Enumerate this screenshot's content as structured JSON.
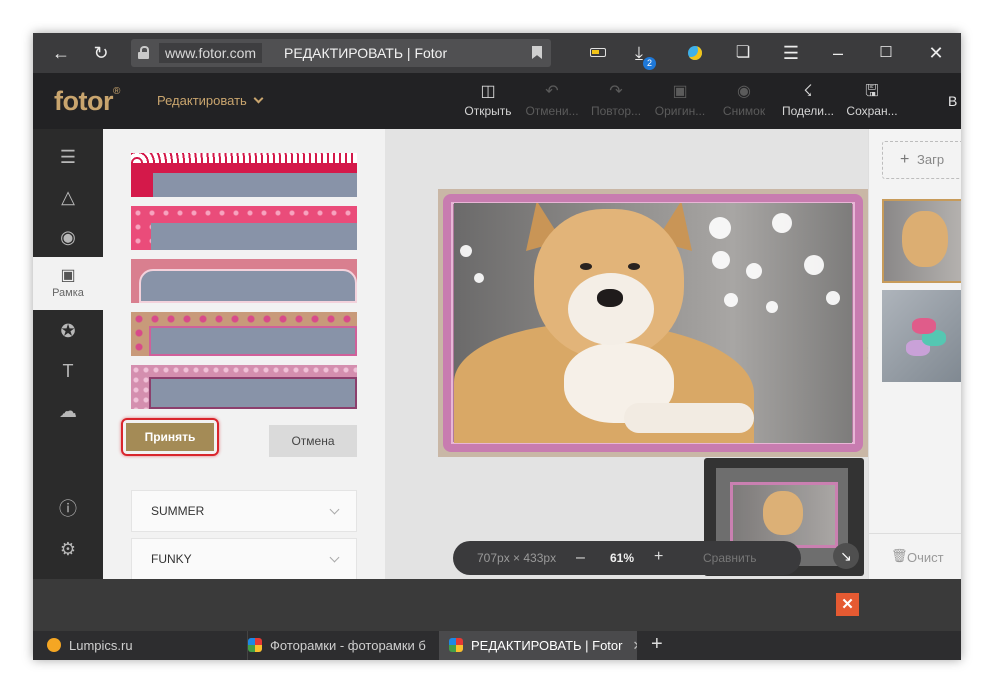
{
  "browser": {
    "domain": "www.fotor.com",
    "page_title": "РЕДАКТИРОВАТЬ | Fotor",
    "download_count": "2",
    "icons": [
      "back-icon",
      "reload-icon",
      "lock-icon",
      "bookmark-icon",
      "battery-icon",
      "download-icon",
      "weather-icon",
      "collections-icon",
      "menu-icon",
      "minimize-icon",
      "maximize-icon",
      "close-icon"
    ]
  },
  "app": {
    "logo": "fotor",
    "logo_mark": "®",
    "edit_menu": "Редактировать",
    "toolbar": {
      "open": "Открыть",
      "undo": "Отмени...",
      "redo": "Повтор...",
      "original": "Оригин...",
      "snapshot": "Снимок",
      "share": "Подели...",
      "save": "Сохран..."
    },
    "user_initial": "В"
  },
  "sidebar": {
    "active_label": "Рамка",
    "icons": [
      "adjust-icon",
      "beauty-icon",
      "eye-icon",
      "frame-icon",
      "sticker-icon",
      "text-icon",
      "cloud-upload-icon",
      "help-icon",
      "settings-icon"
    ]
  },
  "frames_panel": {
    "accept_label": "Принять",
    "cancel_label": "Отмена",
    "categories": [
      "SUMMER",
      "FUNKY"
    ]
  },
  "canvas": {
    "dimensions": "707px × 433px",
    "zoom": "61%",
    "compare": "Сравнить"
  },
  "right_panel": {
    "add_label": "Загр",
    "clear_label": "Очист"
  },
  "tabs": [
    {
      "label": "Lumpics.ru"
    },
    {
      "label": "Фоторамки - фоторамки б"
    },
    {
      "label": "РЕДАКТИРОВАТЬ | Fotor"
    }
  ],
  "colors": {
    "accent_gold": "#c9a56e",
    "accept_button": "#a48b56",
    "highlight_red": "#d9252c"
  }
}
